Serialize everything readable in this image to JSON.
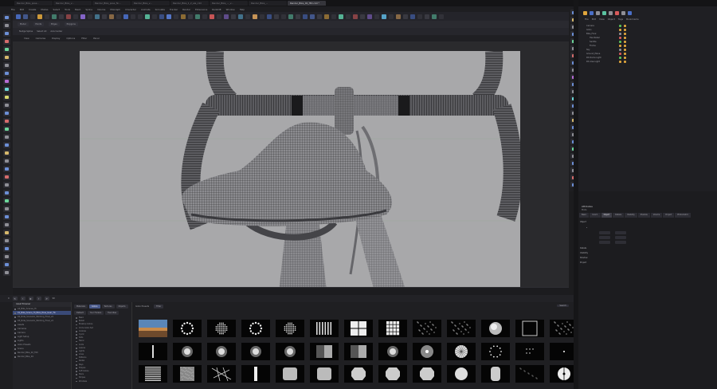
{
  "tabs": [
    {
      "label": "Render_Bike_pose..."
    },
    {
      "label": "Render_Bike_v..."
    },
    {
      "label": "Render_Bike_pose_fin..."
    },
    {
      "label": "Render_Bike_v..."
    },
    {
      "label": "Render_Bike_1_2_ele_c4d"
    },
    {
      "label": "Render_Bike_..._v..."
    },
    {
      "label": "Render_Bike_..."
    },
    {
      "label": "Render_Bike_02_f3D.c4d *"
    }
  ],
  "menu": [
    "File",
    "Edit",
    "Create",
    "Modes",
    "Select",
    "Tools",
    "Mesh",
    "Spline",
    "Volume",
    "MoGraph",
    "Character",
    "Animate",
    "Simulate",
    "Tracker",
    "Render",
    "Extensions",
    "Redshift",
    "Window",
    "Help"
  ],
  "toolbar2": {
    "item1": "Model",
    "item2": "Points",
    "item3": "Edges",
    "item4": "Polygons"
  },
  "toolbar3": {
    "left": "Nudge Spline",
    "mid": "Select All",
    "right": "Axis Center"
  },
  "viewport": {
    "menu": [
      "View",
      "Cameras",
      "Display",
      "Options",
      "Filter",
      "Panel"
    ],
    "status": "Grid Spacing : 10 cm"
  },
  "file_browser": {
    "title": "Asset Browser",
    "items": [
      "All_Bike_Scenes_Hi",
      "01_Bike_Scene_Hi_Bike_Pose_Gear_Fin",
      "02_Ride_Scenario_Working_Final_v4",
      "03_Ride_Scenario_Working_Final_v4",
      "Assets",
      "Cameras",
      "Camera",
      "Light Setup",
      "Lights",
      "Gobo Presets",
      "Scene",
      "Render_Bike_02_f3D",
      "Render_Bike_04"
    ],
    "selected_index": 1
  },
  "categories": {
    "tabs": [
      "Materials",
      "Gobos",
      "Textures",
      "Objects"
    ],
    "active_tab": 1,
    "subtabs": [
      "Default",
      "Your Folders",
      "Favorites"
    ],
    "items": [
      "Basic",
      "Bokeh",
      "Breakup Gobos",
      "Circle Gobo Set",
      "Cookies",
      "Cyclic",
      "Dots",
      "Fabric",
      "Grids",
      "Leaves",
      "Lights",
      "Lines",
      "Patterns",
      "Radial",
      "Rays",
      "Shapes",
      "Soft Gobos",
      "Stars",
      "Stripes",
      "Windows"
    ]
  },
  "presets": {
    "header": "Gobo Presets",
    "filter": "Filter",
    "search_label": "Search",
    "rows": [
      [
        "Studio HDRI",
        "Circle Dots",
        "Dot Grid",
        "Ring Dots",
        "Circle Grid",
        "Blinds Vertical",
        "Window Frame",
        "Square Grid",
        "Star Scatter",
        "Dot Scatter",
        "Soft Sphere",
        "Square Frame",
        "Sparse Lights"
      ],
      [
        "Vertical Bar",
        "Soft Spot",
        "Soft Glow",
        "Soft Falloff",
        "Radial Soft",
        "Gradient Bar",
        "Gradient Band",
        "Ring Spot",
        "Dome Pattern",
        "Wheel Pattern",
        "Dots Ring",
        "Dot Cluster",
        "Corner Dot"
      ],
      [
        "Horizontal Blinds",
        "Blinds Square",
        "Cracks",
        "Light Shaft",
        "Soft Box",
        "Soft Rectangle",
        "Round Spot",
        "Octagon Spot",
        "Octagon Soft",
        "Glow Orb",
        "Capsule",
        "Sparse Stars",
        "Target"
      ]
    ]
  },
  "object_manager": {
    "menu": [
      "File",
      "Edit",
      "View",
      "Object",
      "Tags",
      "Bookmarks"
    ],
    "objects": [
      {
        "name": "Camera",
        "indent": 0
      },
      {
        "name": "Gobo",
        "indent": 0
      },
      {
        "name": "Bike_Final",
        "indent": 0
      },
      {
        "name": "Handlebar",
        "indent": 1
      },
      {
        "name": "Saddle",
        "indent": 1
      },
      {
        "name": "Frame",
        "indent": 1
      },
      {
        "name": "Sky",
        "indent": 0
      },
      {
        "name": "Ground_Plane",
        "indent": 0
      },
      {
        "name": "RS Dome Light",
        "indent": 0
      },
      {
        "name": "RS Area Light",
        "indent": 0
      }
    ]
  },
  "attributes": {
    "title": "Attributes",
    "mode": "Mode",
    "tabs": [
      "Basic",
      "Coord.",
      "Object",
      "Details",
      "Visibility",
      "Shadow",
      "Volume",
      "Project",
      "Photometric"
    ],
    "active_tab": 2,
    "section_object": "Object",
    "section_details": "Details",
    "section_visibility": "Visibility",
    "section_shadow": "Shadow",
    "section_project": "Project"
  },
  "timeline": {
    "frame_start": "0",
    "frame_end": "90"
  }
}
